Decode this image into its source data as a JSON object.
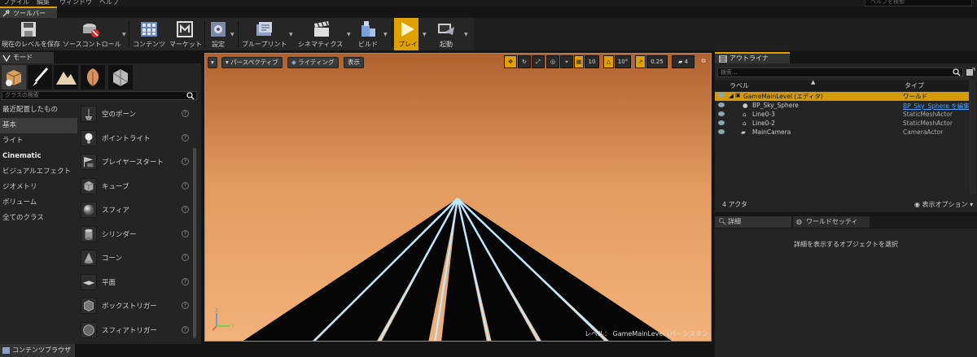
{
  "menu": {
    "items": [
      "ファイル",
      "編集",
      "ウィンドウ",
      "ヘルプ"
    ],
    "help_search_placeholder": "ヘルプを検索"
  },
  "toolbar_tab": {
    "label": "ツールバー"
  },
  "toolbar": {
    "save": "現在のレベルを保存",
    "source_control": "ソースコントロール",
    "content": "コンテンツ",
    "marketplace": "マーケット",
    "settings": "設定",
    "blueprints": "ブループリント",
    "cinematics": "シネマティクス",
    "build": "ビルド",
    "play": "プレイ",
    "launch": "起動"
  },
  "modes": {
    "tab_label": "モード",
    "search_placeholder": "クラスの検索",
    "categories": [
      "最近配置したもの",
      "基本",
      "ライト",
      "Cinematic",
      "ビジュアルエフェクト",
      "ジオメトリ",
      "ボリューム",
      "全てのクラス"
    ],
    "actors": [
      "空のポーン",
      "ポイントライト",
      "プレイヤースタート",
      "キューブ",
      "スフィア",
      "シリンダー",
      "コーン",
      "平面",
      "ボックストリガー",
      "スフィアトリガー"
    ]
  },
  "viewport": {
    "perspective": "パースペクティブ",
    "lighting": "ライティング",
    "show": "表示",
    "grid_snap": "10",
    "rot_snap": "10°",
    "scale_snap": "0.25",
    "camera_speed": "4",
    "level_label": "レベル：  GameMainLevel (パーシスタント)",
    "sky_top": "#b0622e",
    "sky_bottom": "#f2b27a",
    "line_glow": "#bfe8ff"
  },
  "outliner": {
    "tab_label": "アウトライナ",
    "search_placeholder": "検索...",
    "col_label": "ラベル",
    "col_type": "タイプ",
    "rows": [
      {
        "name": "GameMainLevel (エディタ)",
        "type": "ワールド"
      },
      {
        "name": "BP_Sky_Sphere",
        "type": "BP_Sky_Sphere を編集"
      },
      {
        "name": "Line0-3",
        "type": "StaticMeshActor"
      },
      {
        "name": "Line0-2",
        "type": "StaticMeshActor"
      },
      {
        "name": "MainCamera",
        "type": "CameraActor"
      }
    ],
    "count": "4 アクタ",
    "view_options": "表示オプション"
  },
  "details": {
    "tab_details": "詳細",
    "tab_world": "ワールドセッティ",
    "empty": "詳細を表示するオブジェクトを選択"
  },
  "content_browser": {
    "tab_label": "コンテンツブラウザ"
  },
  "accent": "#e0a000"
}
